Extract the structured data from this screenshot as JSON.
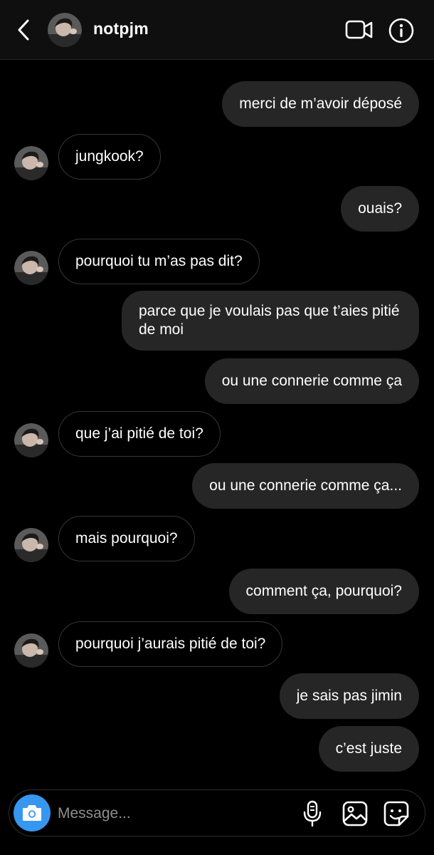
{
  "header": {
    "username": "notpjm",
    "icons": {
      "back": "chevron-left-icon",
      "video": "video-call-icon",
      "info": "info-icon"
    }
  },
  "messages": [
    {
      "from": "me",
      "text": "merci de m’avoir déposé"
    },
    {
      "from": "them",
      "text": "jungkook?"
    },
    {
      "from": "me",
      "text": "ouais?"
    },
    {
      "from": "them",
      "text": "pourquoi tu m’as pas dit?"
    },
    {
      "from": "me",
      "text": "parce que je voulais pas que t’aies pitié de moi"
    },
    {
      "from": "me",
      "text": "ou une connerie comme ça"
    },
    {
      "from": "them",
      "text": "que j’ai pitié de toi?"
    },
    {
      "from": "me",
      "text": "ou une connerie comme ça..."
    },
    {
      "from": "them",
      "text": "mais pourquoi?"
    },
    {
      "from": "me",
      "text": "comment ça, pourquoi?"
    },
    {
      "from": "them",
      "text": "pourquoi j’aurais pitié de toi?"
    },
    {
      "from": "me",
      "text": "je sais pas jimin"
    },
    {
      "from": "me",
      "text": "c’est juste"
    }
  ],
  "composer": {
    "placeholder": "Message...",
    "value": "",
    "icons": {
      "camera": "camera-icon",
      "mic": "microphone-icon",
      "gallery": "gallery-icon",
      "sticker": "sticker-icon"
    }
  },
  "colors": {
    "background": "#000000",
    "sent_bubble": "#262626",
    "received_border": "#363636",
    "camera_button": "#3797f0",
    "placeholder": "#8e8e8e"
  }
}
